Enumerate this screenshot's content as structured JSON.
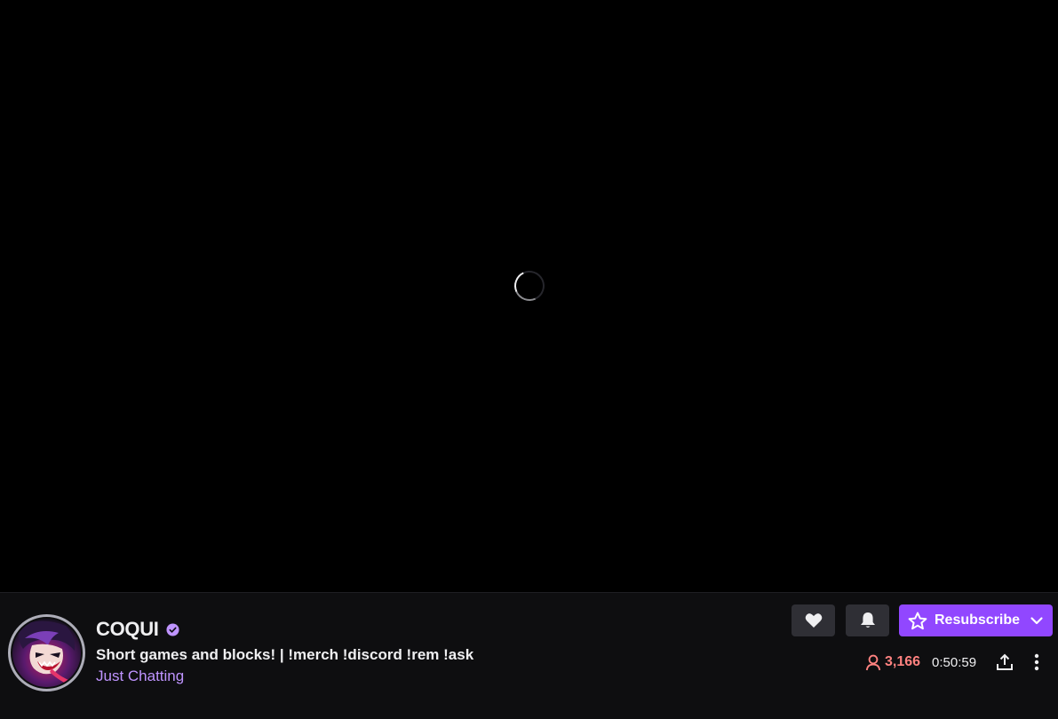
{
  "channel": {
    "name": "COQUI",
    "verified": true,
    "stream_title": "Short games and blocks! | !merch !discord !rem !ask",
    "category": "Just Chatting"
  },
  "actions": {
    "follow_icon": "heart-icon",
    "notify_icon": "bell-icon",
    "resubscribe_label": "Resubscribe",
    "resubscribe_icon": "star-icon",
    "dropdown_icon": "chevron-down-icon"
  },
  "stats": {
    "viewer_count": "3,166",
    "uptime": "0:50:59"
  },
  "colors": {
    "accent": "#9147ff",
    "category": "#bf94ff",
    "viewers": "#ff8280",
    "verified": "#bf94ff",
    "player_bg": "#000000",
    "panel_bg": "#0e0e10"
  }
}
